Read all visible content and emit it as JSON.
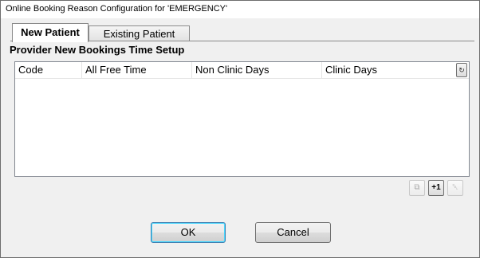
{
  "window": {
    "title": "Online Booking Reason Configuration for 'EMERGENCY'"
  },
  "tabs": [
    {
      "label": "New Patient",
      "active": true
    },
    {
      "label": "Existing Patient",
      "active": false
    }
  ],
  "section": {
    "title": "Provider New Bookings Time Setup"
  },
  "grid": {
    "columns": [
      "Code",
      "All Free Time",
      "Non Clinic Days",
      "Clinic Days"
    ],
    "rows": [],
    "refresh_icon": "↻"
  },
  "row_actions": {
    "copy_glyph": "⧉",
    "add_label": "+1",
    "delete_glyph": "␡"
  },
  "buttons": {
    "ok": "OK",
    "cancel": "Cancel"
  }
}
